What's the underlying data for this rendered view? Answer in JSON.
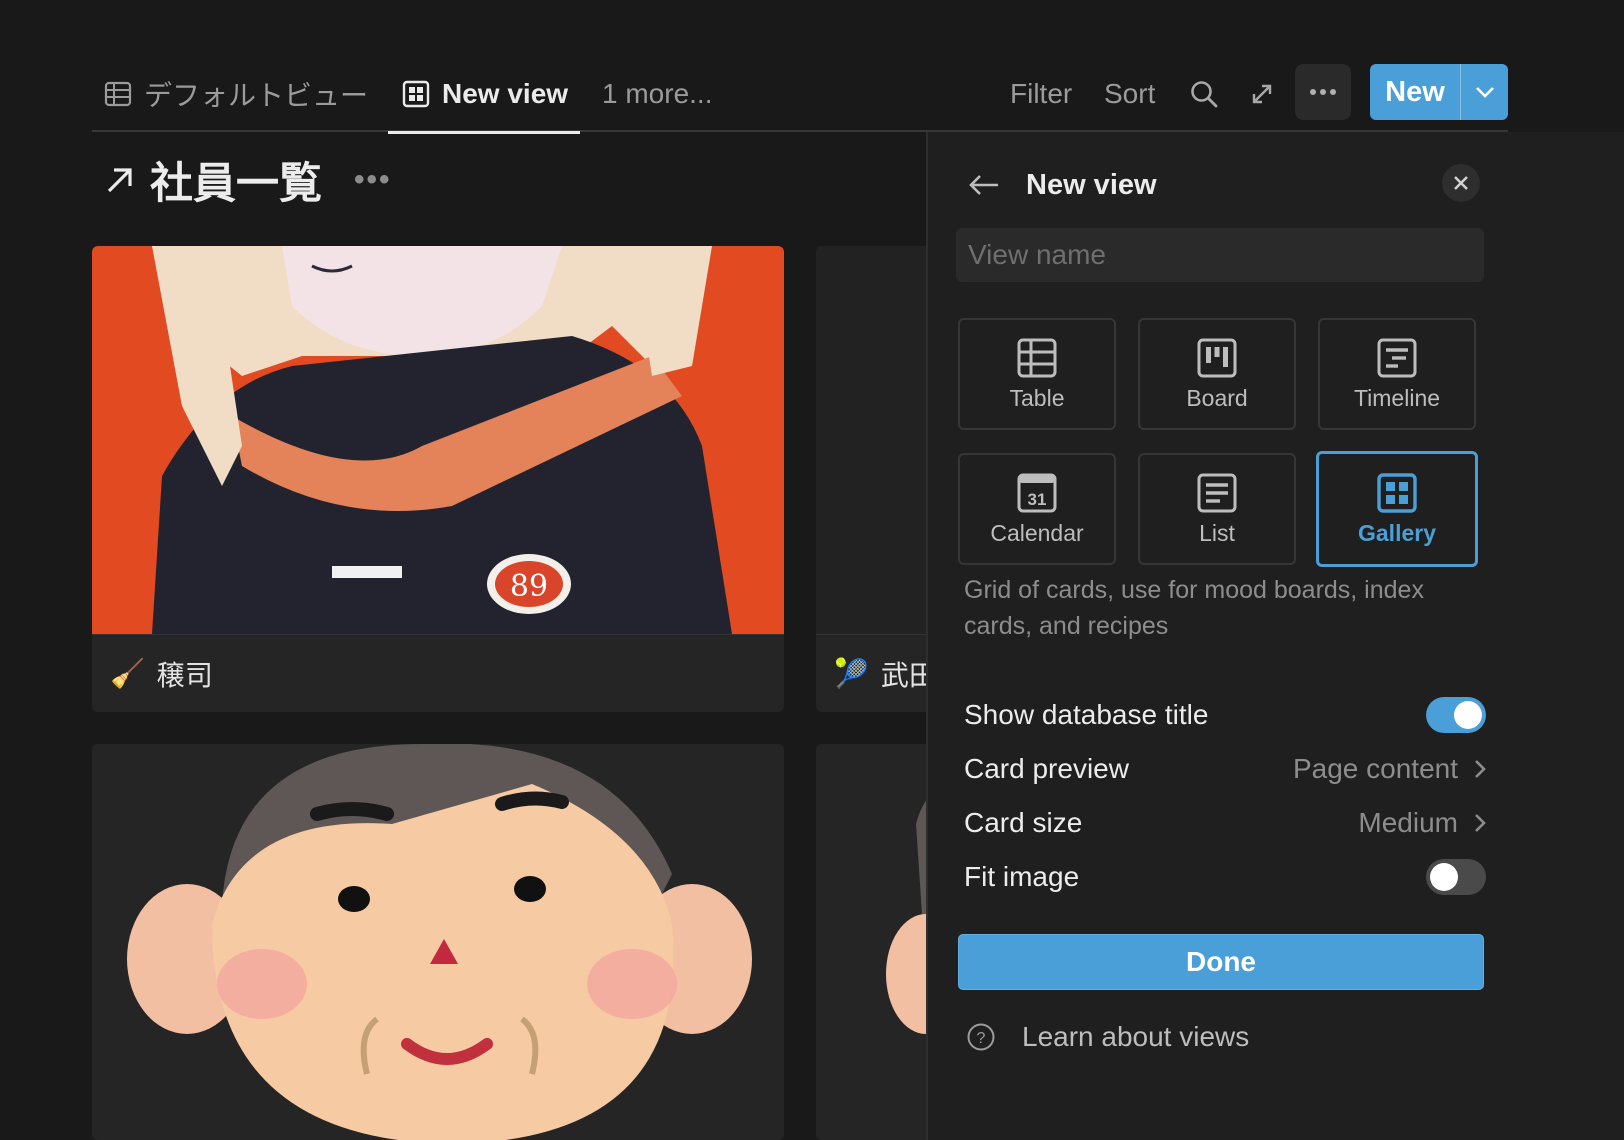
{
  "tabs": {
    "default_view": "デフォルトビュー",
    "new_view": "New view",
    "more": "1 more..."
  },
  "toolbar": {
    "filter": "Filter",
    "sort": "Sort",
    "new": "New"
  },
  "database": {
    "title": "社員一覧"
  },
  "cards": [
    {
      "name": "穣司",
      "emoji": "🧹"
    },
    {
      "name": "武田",
      "emoji": "🎾"
    }
  ],
  "panel": {
    "title": "New view",
    "view_name_placeholder": "View name",
    "view_types": [
      "Table",
      "Board",
      "Timeline",
      "Calendar",
      "List",
      "Gallery"
    ],
    "selected_type": "Gallery",
    "calendar_day": "31",
    "description": "Grid of cards, use for mood boards, index cards, and recipes",
    "options": {
      "show_db_title": {
        "label": "Show database title",
        "enabled": true
      },
      "card_preview": {
        "label": "Card preview",
        "value": "Page content"
      },
      "card_size": {
        "label": "Card size",
        "value": "Medium"
      },
      "fit_image": {
        "label": "Fit image",
        "enabled": false
      }
    },
    "done": "Done",
    "learn": "Learn about views"
  },
  "colors": {
    "accent": "#4a9fd8",
    "background": "#191919",
    "panel": "#1f1f1f"
  }
}
